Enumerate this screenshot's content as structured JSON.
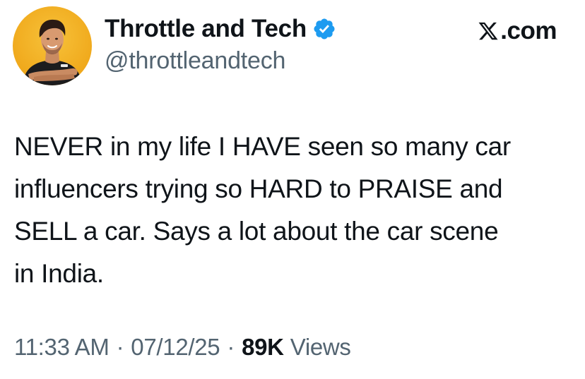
{
  "author": {
    "display_name": "Throttle and Tech",
    "handle": "@throttleandtech",
    "verified": true,
    "verified_badge_color": "#1d9bf0",
    "avatar_icon": "person-avatar-icon",
    "avatar_background": "#f0a91c"
  },
  "brand": {
    "logo_icon": "x-logo-icon",
    "suffix": ".com"
  },
  "tweet": {
    "lines": [
      "NEVER in my life I HAVE seen so many car",
      "influencers trying so HARD to PRAISE and",
      "SELL a car. Says a lot about the car scene",
      "in India."
    ]
  },
  "meta": {
    "time": "11:33 AM",
    "separator": "·",
    "date": "07/12/25",
    "views_count": "89K",
    "views_label": "Views"
  }
}
